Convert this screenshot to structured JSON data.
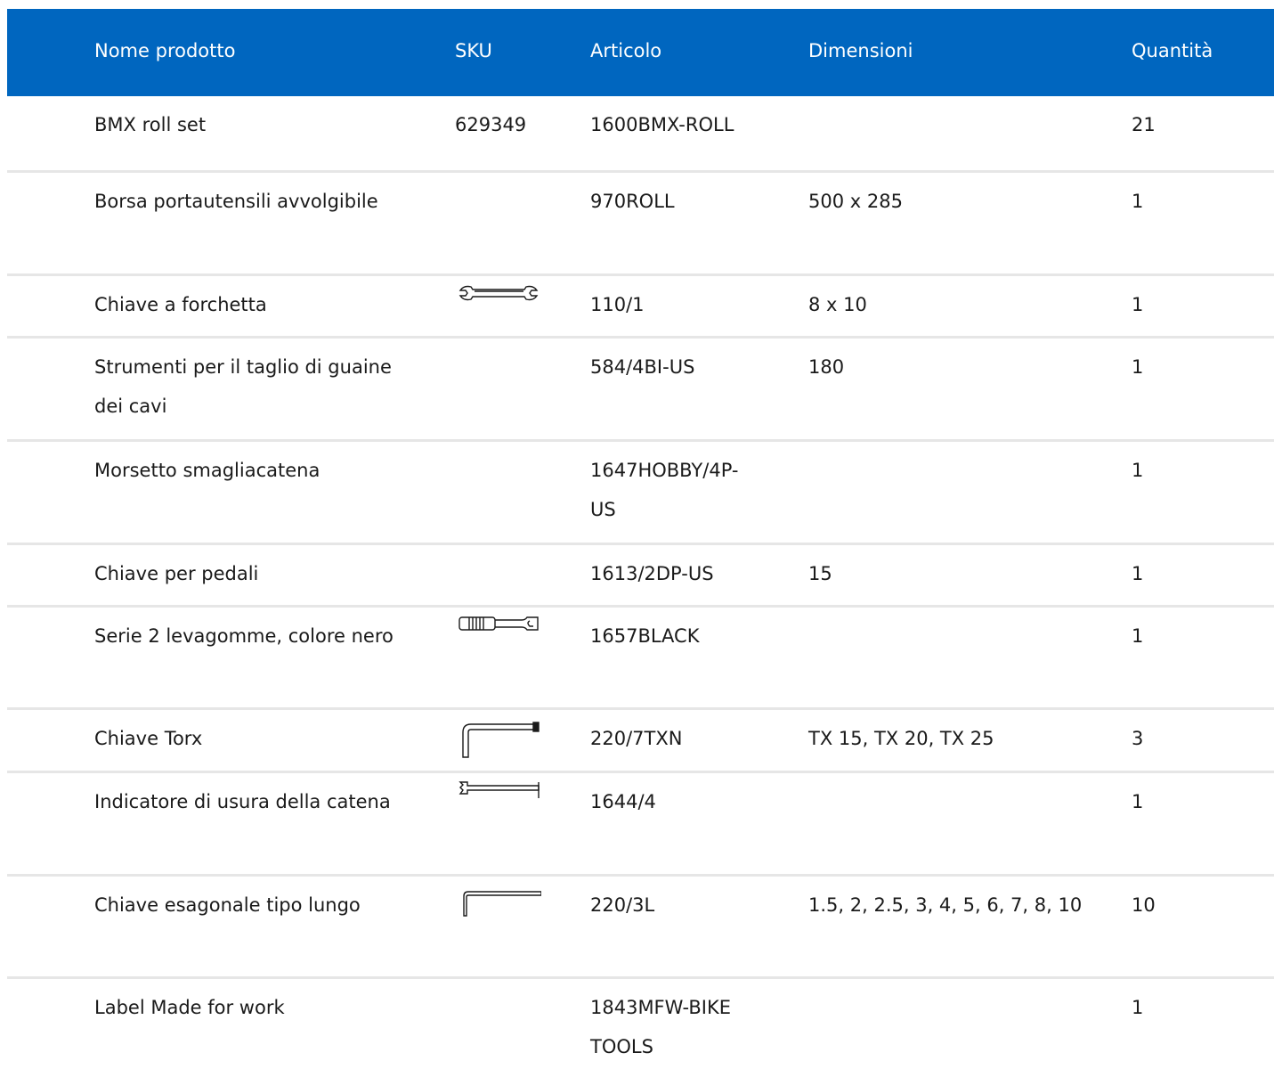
{
  "colors": {
    "header_bg": "#0066bf",
    "header_text": "#ffffff",
    "row_border": "#e6e6e6"
  },
  "header": {
    "name": "Nome prodotto",
    "sku": "SKU",
    "article": "Articolo",
    "dimensions": "Dimensioni",
    "quantity": "Quantità"
  },
  "rows": [
    {
      "name": "BMX roll set",
      "sku": "629349",
      "article": "1600BMX-ROLL",
      "dimensions": "",
      "quantity": "21",
      "icon": ""
    },
    {
      "name": "Borsa portautensili avvolgibile",
      "sku": "",
      "article": "970ROLL",
      "dimensions": "500 x 285",
      "quantity": "1",
      "icon": ""
    },
    {
      "name": "Chiave a forchetta",
      "sku": "",
      "article": "110/1",
      "dimensions": "8 x 10",
      "quantity": "1",
      "icon": "open-end-wrench-icon"
    },
    {
      "name": "Strumenti per il taglio di guaine dei cavi",
      "sku": "",
      "article": "584/4BI-US",
      "dimensions": "180",
      "quantity": "1",
      "icon": ""
    },
    {
      "name": "Morsetto smagliacatena",
      "sku": "",
      "article": "1647HOBBY/4P-US",
      "dimensions": "",
      "quantity": "1",
      "icon": ""
    },
    {
      "name": "Chiave per pedali",
      "sku": "",
      "article": "1613/2DP-US",
      "dimensions": "15",
      "quantity": "1",
      "icon": ""
    },
    {
      "name": "Serie 2 levagomme, colore nero",
      "sku": "",
      "article": "1657BLACK",
      "dimensions": "",
      "quantity": "1",
      "icon": "tire-lever-icon"
    },
    {
      "name": "Chiave Torx",
      "sku": "",
      "article": "220/7TXN",
      "dimensions": "TX 15, TX 20, TX 25",
      "quantity": "3",
      "icon": "torx-key-icon"
    },
    {
      "name": "Indicatore di usura della catena",
      "sku": "",
      "article": "1644/4",
      "dimensions": "",
      "quantity": "1",
      "icon": "chain-wear-gauge-icon"
    },
    {
      "name": "Chiave esagonale tipo lungo",
      "sku": "",
      "article": "220/3L",
      "dimensions": "1.5, 2, 2.5, 3, 4, 5, 6, 7, 8, 10",
      "quantity": "10",
      "icon": "hex-key-icon"
    },
    {
      "name": "Label Made for work",
      "sku": "",
      "article": "1843MFW-BIKE TOOLS",
      "dimensions": "",
      "quantity": "1",
      "icon": ""
    }
  ]
}
